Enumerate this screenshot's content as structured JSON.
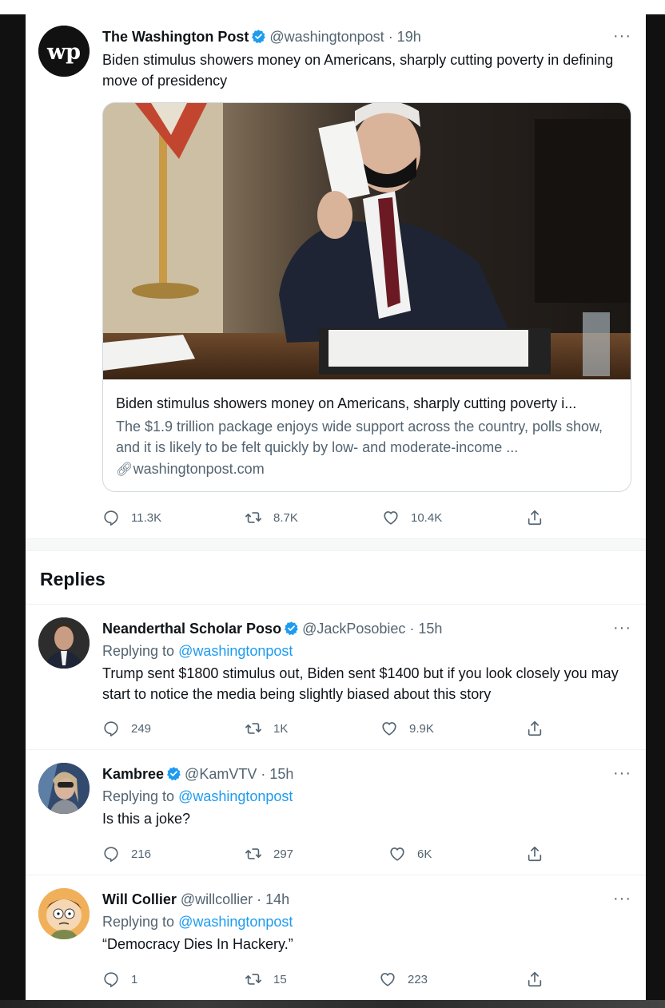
{
  "main_tweet": {
    "author_name": "The Washington Post",
    "handle_time": "@washingtonpost · 19h",
    "more": "···",
    "text": "Biden stimulus showers money on Americans, sharply cutting poverty in defining move of presidency",
    "card": {
      "title": "Biden stimulus showers money on Americans, sharply cutting poverty i...",
      "description": "The $1.9 trillion package enjoys wide support across the country, polls show, and it is likely to be felt quickly by low- and moderate-income ...",
      "domain": "washingtonpost.com"
    },
    "stats": {
      "replies": "11.3K",
      "retweets": "8.7K",
      "likes": "10.4K"
    }
  },
  "replies_heading": "Replies",
  "replies": [
    {
      "author_name": "Neanderthal Scholar Poso",
      "handle_time": "@JackPosobiec · 15h",
      "replying_prefix": "Replying to",
      "replying_to": "@washingtonpost",
      "text": "Trump sent $1800 stimulus out, Biden sent $1400 but if you look closely you may start to notice the media being slightly biased about this story",
      "stats": {
        "replies": "249",
        "retweets": "1K",
        "likes": "9.9K"
      }
    },
    {
      "author_name": "Kambree",
      "handle_time": "@KamVTV · 15h",
      "replying_prefix": "Replying to",
      "replying_to": "@washingtonpost",
      "text": "Is this a joke?",
      "stats": {
        "replies": "216",
        "retweets": "297",
        "likes": "6K"
      }
    },
    {
      "author_name": "Will Collier",
      "handle_time": "@willcollier · 14h",
      "replying_prefix": "Replying to",
      "replying_to": "@washingtonpost",
      "text": "“Democracy Dies In Hackery.”",
      "stats": {
        "replies": "1",
        "retweets": "15",
        "likes": "223"
      }
    }
  ],
  "colors": {
    "link": "#1d9bf0",
    "secondary_text": "#536471",
    "verified": "#1d9bf0"
  }
}
